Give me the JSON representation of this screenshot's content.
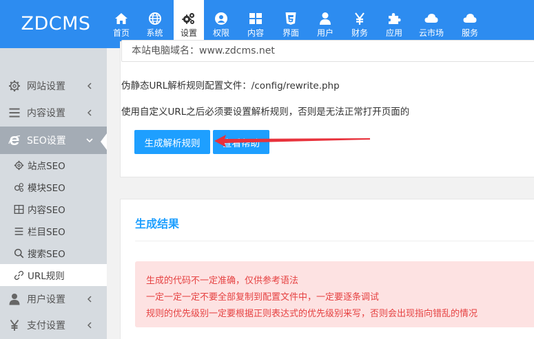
{
  "app": {
    "logo": "ZDCMS"
  },
  "nav": {
    "items": [
      {
        "label": "首页",
        "icon": "home-icon"
      },
      {
        "label": "系统",
        "icon": "globe-icon"
      },
      {
        "label": "设置",
        "icon": "gears-icon",
        "active": true
      },
      {
        "label": "权限",
        "icon": "user-circle-icon"
      },
      {
        "label": "内容",
        "icon": "grid-icon"
      },
      {
        "label": "界面",
        "icon": "html5-icon"
      },
      {
        "label": "用户",
        "icon": "user-icon"
      },
      {
        "label": "财务",
        "icon": "yen-icon"
      },
      {
        "label": "应用",
        "icon": "puzzle-icon"
      },
      {
        "label": "云市场",
        "icon": "cloud-icon"
      },
      {
        "label": "服务",
        "icon": "cloud-icon"
      }
    ]
  },
  "sidebar": {
    "items": [
      {
        "label": "网站设置",
        "icon": "gear-icon"
      },
      {
        "label": "内容设置",
        "icon": "list-icon"
      },
      {
        "label": "SEO设置",
        "icon": "ie-icon",
        "active": true
      },
      {
        "label": "用户设置",
        "icon": "user-icon"
      },
      {
        "label": "支付设置",
        "icon": "yen-icon"
      }
    ],
    "sub_items": [
      {
        "label": "站点SEO",
        "icon": "gear-icon"
      },
      {
        "label": "模块SEO",
        "icon": "gears-icon"
      },
      {
        "label": "内容SEO",
        "icon": "table-icon"
      },
      {
        "label": "栏目SEO",
        "icon": "list-icon"
      },
      {
        "label": "搜索SEO",
        "icon": "search-icon"
      },
      {
        "label": "URL规则",
        "icon": "link-icon",
        "current": true
      }
    ]
  },
  "main": {
    "domain_value": "本站电脑域名：www.zdcms.net",
    "rewrite_text": "伪静态URL解析规则配置文件：/config/rewrite.php",
    "notice_text": "使用自定义URL之后必须要设置解析规则，否则是无法正常打开页面的",
    "generate_button": "生成解析规则",
    "help_button": "查看帮助"
  },
  "result": {
    "title": "生成结果",
    "alert_lines": [
      "生成的代码不一定准确，仅供参考语法",
      "一定一定一定不要全部复制到配置文件中，一定要逐条调试",
      "规则的优先级别一定要根据正则表达式的优先级别来写，否则会出现指向错乱的情况"
    ]
  },
  "colors": {
    "topbar": "#2d8cf0",
    "button": "#1e9fff",
    "sidebar": "#d6dbe0",
    "sidebar_active": "#a4acb5",
    "alert_bg": "#fde2e2",
    "alert_text": "#e64242",
    "arrow": "#e8323c"
  }
}
